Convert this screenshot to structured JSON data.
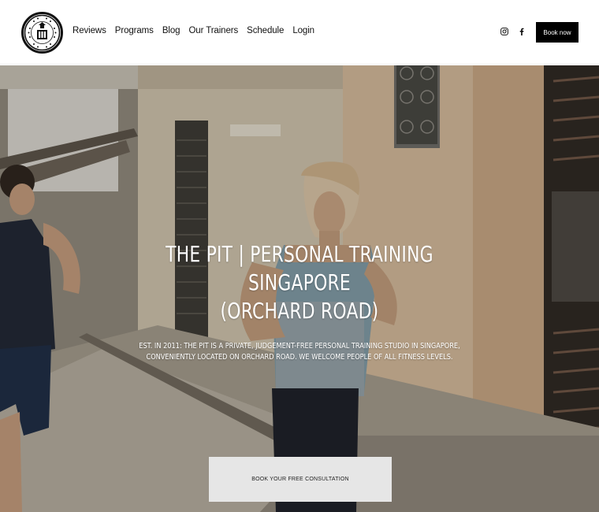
{
  "brand": {
    "logo_text_top": "PERFORMANCE",
    "logo_text_center": "PIT",
    "logo_text_bottom": "TRAINING"
  },
  "nav": {
    "items": [
      {
        "label": "Reviews"
      },
      {
        "label": "Programs"
      },
      {
        "label": "Blog"
      },
      {
        "label": "Our Trainers"
      },
      {
        "label": "Schedule"
      },
      {
        "label": "Login"
      }
    ]
  },
  "social": {
    "instagram_icon": "instagram-icon",
    "facebook_icon": "facebook-icon"
  },
  "header": {
    "book_now_label": "Book now"
  },
  "hero": {
    "title_line1": "THE PIT | PERSONAL TRAINING SINGAPORE",
    "title_line2": "(ORCHARD ROAD)",
    "subtitle_line1": "EST. IN 2011: THE PIT IS A PRIVATE, JUDGEMENT-FREE PERSONAL TRAINING STUDIO IN SINGAPORE,",
    "subtitle_line2": "CONVENIENTLY LOCATED ON ORCHARD ROAD. WE WELCOME PEOPLE OF ALL FITNESS LEVELS.",
    "cta_label": "BOOK YOUR FREE CONSULTATION"
  },
  "colors": {
    "header_bg": "#ffffff",
    "button_dark": "#000000",
    "cta_bg": "#e6e6e6",
    "hero_text": "#ffffff"
  }
}
